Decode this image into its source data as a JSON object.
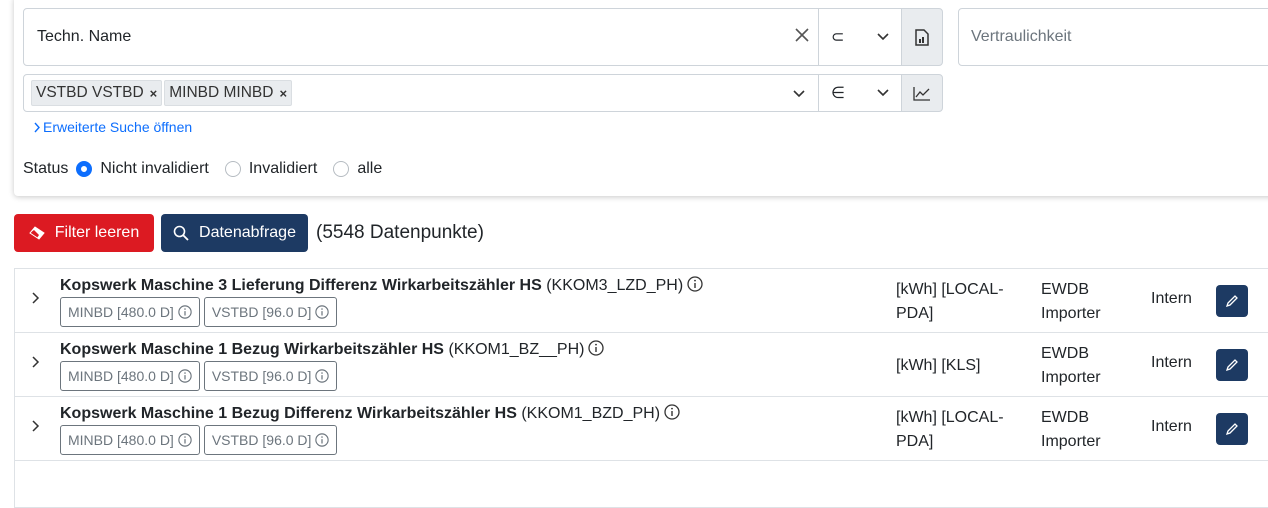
{
  "filters": {
    "techn_name_placeholder": "Techn. Name",
    "clear_symbol": "✕",
    "op1": "⊂",
    "vertraulichkeit_placeholder": "Vertraulichkeit",
    "chips": [
      {
        "label": "VSTBD VSTBD",
        "x": "×"
      },
      {
        "label": "MINBD MINBD",
        "x": "×"
      }
    ],
    "op2": "∈",
    "advanced_link": "Erweiterte Suche öffnen",
    "status_label": "Status",
    "status_options": [
      "Nicht invalidiert",
      "Invalidiert",
      "alle"
    ],
    "status_selected": "Nicht invalidiert"
  },
  "actions": {
    "clear_filter": "Filter leeren",
    "query": "Datenabfrage",
    "count": "(5548 Datenpunkte)"
  },
  "rows": [
    {
      "title": "Kopswerk Maschine 3 Lieferung Differenz Wirkarbeitszähler HS",
      "code": "(KKOM3_LZD_PH)",
      "tags": [
        "MINBD [480.0 D]",
        "VSTBD [96.0 D]"
      ],
      "unit_line1": "[kWh] [LOCAL-",
      "unit_line2": "PDA]",
      "source_line1": "EWDB",
      "source_line2": "Importer",
      "confidentiality": "Intern"
    },
    {
      "title": "Kopswerk Maschine 1 Bezug Wirkarbeitszähler HS",
      "code": "(KKOM1_BZ__PH)",
      "tags": [
        "MINBD [480.0 D]",
        "VSTBD [96.0 D]"
      ],
      "unit_line1": "[kWh] [KLS]",
      "unit_line2": "",
      "source_line1": "EWDB",
      "source_line2": "Importer",
      "confidentiality": "Intern"
    },
    {
      "title": "Kopswerk Maschine 1 Bezug Differenz Wirkarbeitszähler HS",
      "code": "(KKOM1_BZD_PH)",
      "tags": [
        "MINBD [480.0 D]",
        "VSTBD [96.0 D]"
      ],
      "unit_line1": "[kWh] [LOCAL-",
      "unit_line2": "PDA]",
      "source_line1": "EWDB",
      "source_line2": "Importer",
      "confidentiality": "Intern"
    }
  ],
  "colors": {
    "primary": "#0d6efd",
    "danger": "#dc1a22",
    "dark_blue": "#1d3a63"
  }
}
